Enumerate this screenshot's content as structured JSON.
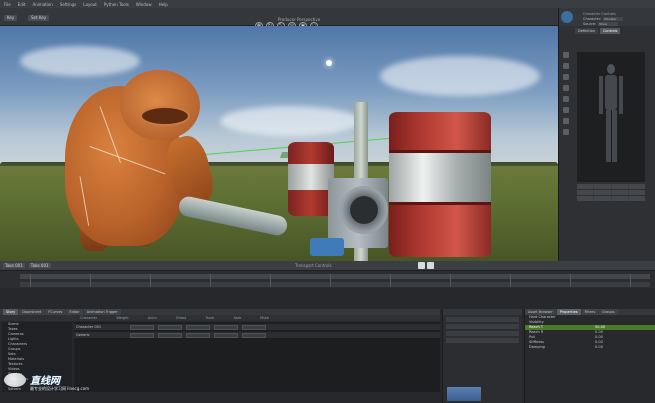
{
  "menubar": {
    "items": [
      "File",
      "Edit",
      "Animation",
      "Settings",
      "Layout",
      "Python Tools",
      "Window",
      "Help"
    ]
  },
  "toolbar": {
    "buttons": [
      "Key",
      "Set Key"
    ],
    "viewport_title": "Producer Perspective"
  },
  "viewport": {
    "scene": "monster-in-field"
  },
  "right_panel": {
    "title": "Character Controls",
    "fields": [
      {
        "label": "Character:",
        "value": "Monster"
      },
      {
        "label": "Source:",
        "value": "None"
      }
    ],
    "tabs": [
      {
        "label": "Definition",
        "active": false
      },
      {
        "label": "Controls",
        "active": true
      }
    ]
  },
  "transport": {
    "left_buttons": [
      "Take 001",
      "Take 001"
    ],
    "title": "Transport Controls"
  },
  "story": {
    "tabs": [
      {
        "label": "Story",
        "active": true
      },
      {
        "label": "Dopesheet",
        "active": false
      },
      {
        "label": "FCurves",
        "active": false
      },
      {
        "label": "Editor",
        "active": false
      },
      {
        "label": "Animation Trigger",
        "active": false
      }
    ],
    "columns": [
      "Character",
      "Weight",
      "Anim",
      "Ghost",
      "Track",
      "Solo",
      "Mute"
    ],
    "tree": [
      "Scene",
      "Takes",
      "Cameras",
      "Lights",
      "Characters",
      "Groups",
      "Sets",
      "Materials",
      "Textures",
      "Videos",
      "Shaders",
      "Constraints",
      "Poses",
      "Solvers"
    ],
    "tracks": [
      {
        "label": "Character 001"
      },
      {
        "label": "Generic"
      }
    ]
  },
  "properties": {
    "tabs": [
      {
        "label": "Asset Browser",
        "active": false
      },
      {
        "label": "Properties",
        "active": true
      },
      {
        "label": "Filters",
        "active": false
      },
      {
        "label": "Groups",
        "active": false
      }
    ],
    "rows": [
      {
        "label": "Hard Character",
        "value": ""
      },
      {
        "label": "Visibility",
        "value": ""
      },
      {
        "label": "Reach T",
        "value": "50.00",
        "highlight": true
      },
      {
        "label": "Reach R",
        "value": "0.00",
        "highlight": false
      },
      {
        "label": "Pull",
        "value": "0.00",
        "highlight": false
      },
      {
        "label": "Stiffness",
        "value": "0.00",
        "highlight": false
      },
      {
        "label": "Damping",
        "value": "0.00",
        "highlight": false
      }
    ]
  },
  "watermark": {
    "title": "直线网",
    "subtitle": "最专业的设计学习网 linecg.com"
  }
}
